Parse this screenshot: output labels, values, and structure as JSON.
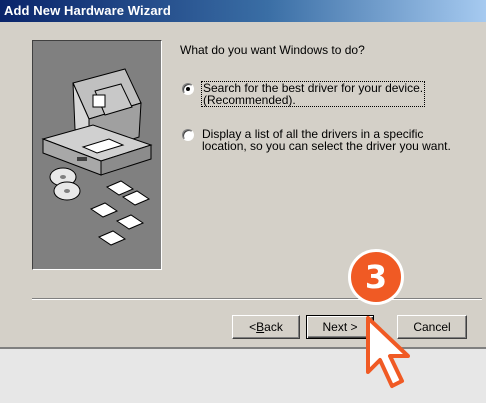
{
  "window": {
    "title": "Add New Hardware Wizard"
  },
  "main": {
    "question": "What do you want Windows to do?",
    "options": [
      {
        "line1": "Search for the best driver for your device.",
        "line2": "(Recommended).",
        "selected": true
      },
      {
        "line1": "Display a list of all the drivers in a specific",
        "line2": "location, so you can select the driver you want.",
        "selected": false
      }
    ]
  },
  "buttons": {
    "back_prefix": "< ",
    "back_mnemonic": "B",
    "back_rest": "ack",
    "next": "Next >",
    "cancel": "Cancel"
  },
  "overlay": {
    "step_number": "3",
    "badge_color": "#f05a24"
  },
  "icons": [
    "computer-icon",
    "cd-icon",
    "floppy-disk-icon",
    "hand-pointer-cursor-icon"
  ]
}
